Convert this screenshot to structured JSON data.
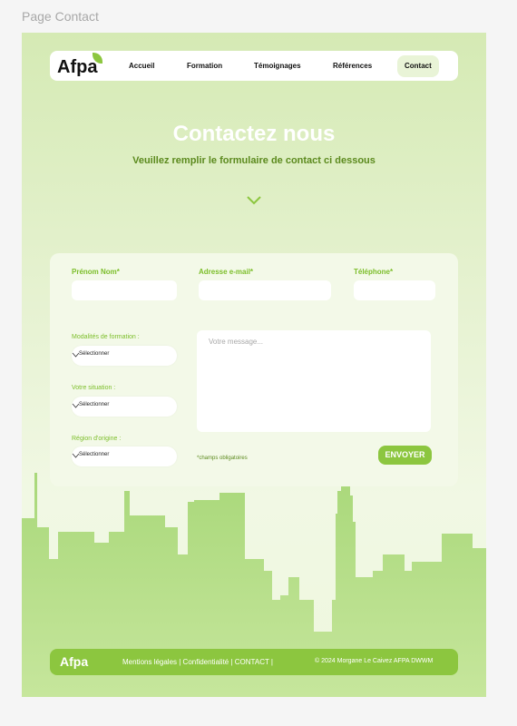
{
  "frame": {
    "label": "Page Contact"
  },
  "brand": {
    "logo": "Afpa",
    "accent": "#8cc63f",
    "dark_green": "#5c8a1e"
  },
  "nav": {
    "items": [
      {
        "label": "Accueil",
        "active": false
      },
      {
        "label": "Formation",
        "active": false
      },
      {
        "label": "Témoignages",
        "active": false
      },
      {
        "label": "Références",
        "active": false
      },
      {
        "label": "Contact",
        "active": true
      }
    ]
  },
  "hero": {
    "title": "Contactez nous",
    "subtitle": "Veuillez remplir le formulaire de contact ci dessous",
    "scroll_icon": "chevron-down-icon"
  },
  "form": {
    "name_label": "Prénom Nom*",
    "email_label": "Adresse e-mail*",
    "phone_label": "Téléphone*",
    "name_value": "",
    "email_value": "",
    "phone_value": "",
    "modalites_label": "Modalités de formation :",
    "modalites_value": "Sélectionner",
    "situation_label": "Votre situation :",
    "situation_value": "Sélectionner",
    "region_label": "Région d'origine :",
    "region_value": "Sélectionner",
    "message_placeholder": "Votre message...",
    "required_note": "*champs obligatoires",
    "submit_label": "ENVOYER"
  },
  "footer": {
    "logo": "Afpa",
    "links": "Mentions légales | Confidentialité | CONTACT |",
    "copyright": "© 2024 Morgane Le Caivez AFPA DWWM"
  }
}
